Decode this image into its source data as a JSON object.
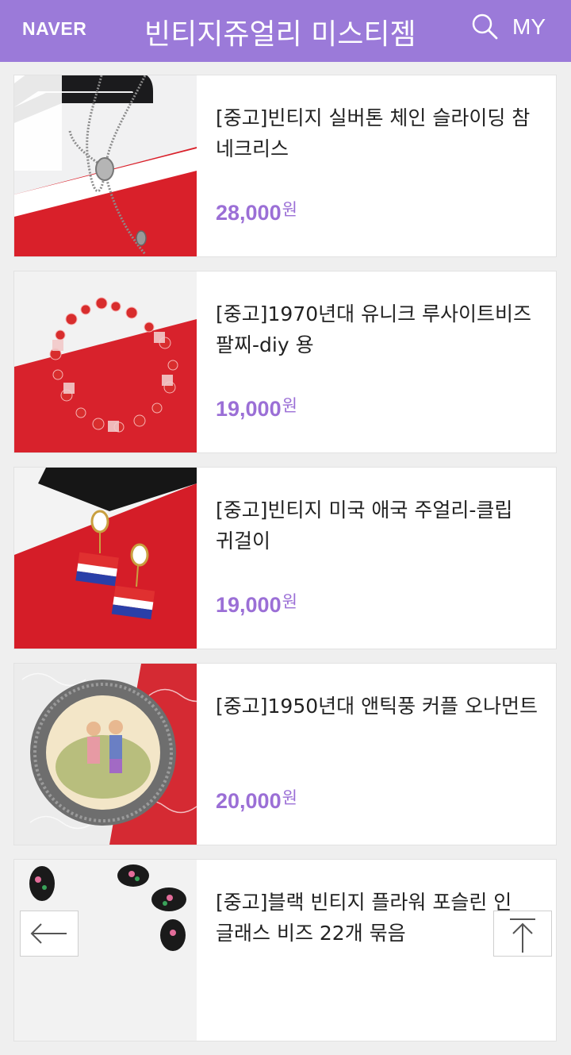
{
  "header": {
    "brand": "NAVER",
    "title": "빈티지쥬얼리 미스티젬",
    "my_label": "MY",
    "search_icon": "search-icon",
    "bg_color": "#9b7ad9"
  },
  "products": [
    {
      "title": "[중고]빈티지 실버톤 체인 슬라이딩 참 네크리스",
      "price": "28,000",
      "currency": "원"
    },
    {
      "title": "[중고]1970년대 유니크 루사이트비즈 팔찌-diy 용",
      "price": "19,000",
      "currency": "원"
    },
    {
      "title": "[중고]빈티지 미국 애국 주얼리-클립 귀걸이",
      "price": "19,000",
      "currency": "원"
    },
    {
      "title": "[중고]1950년대 앤틱풍 커플 오나먼트",
      "price": "20,000",
      "currency": "원"
    },
    {
      "title": "[중고]블랙 빈티지 플라워 포슬린 인 글래스 비즈 22개 묶음",
      "price": "",
      "currency": ""
    }
  ],
  "nav": {
    "back_icon": "arrow-left-icon",
    "top_icon": "arrow-up-icon"
  },
  "colors": {
    "price": "#9b6fd6",
    "accent": "#9b7ad9"
  }
}
